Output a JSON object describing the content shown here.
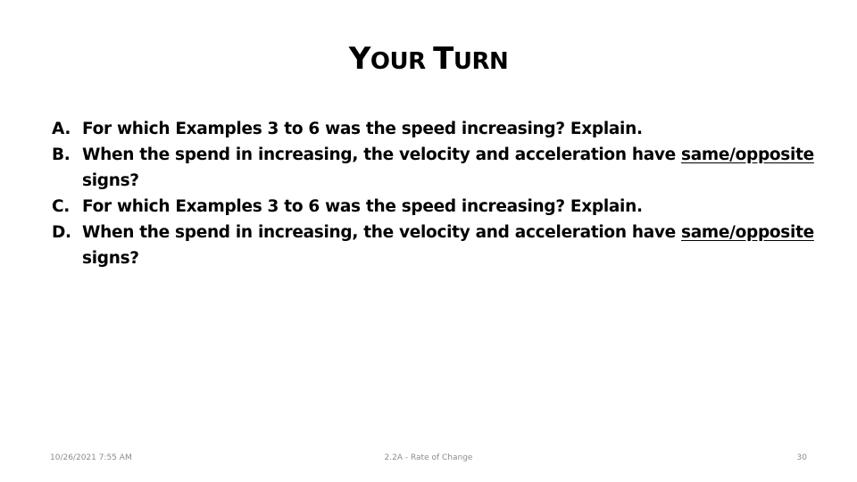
{
  "slide": {
    "title_parts": [
      {
        "text": "Y",
        "size": "big"
      },
      {
        "text": "OUR ",
        "size": "small"
      },
      {
        "text": "T",
        "size": "big"
      },
      {
        "text": "URN",
        "size": "small"
      }
    ],
    "items": [
      {
        "letter": "A.",
        "text": "For which Examples 3 to 6 was the speed increasing? Explain.",
        "underlined": ""
      },
      {
        "letter": "B.",
        "text": "When the spend in increasing, the velocity and acceleration have ",
        "underlined": "same/opposite",
        "after": " signs?"
      },
      {
        "letter": "C.",
        "text": "For which Examples 3 to 6 was the speed increasing? Explain.",
        "underlined": ""
      },
      {
        "letter": "D.",
        "text": "When the spend in increasing, the velocity and acceleration have ",
        "underlined": "same/opposite",
        "after": " signs?"
      }
    ]
  },
  "footer": {
    "date": "10/26/2021 7:55 AM",
    "center": "2.2A - Rate of Change",
    "page": "30"
  }
}
